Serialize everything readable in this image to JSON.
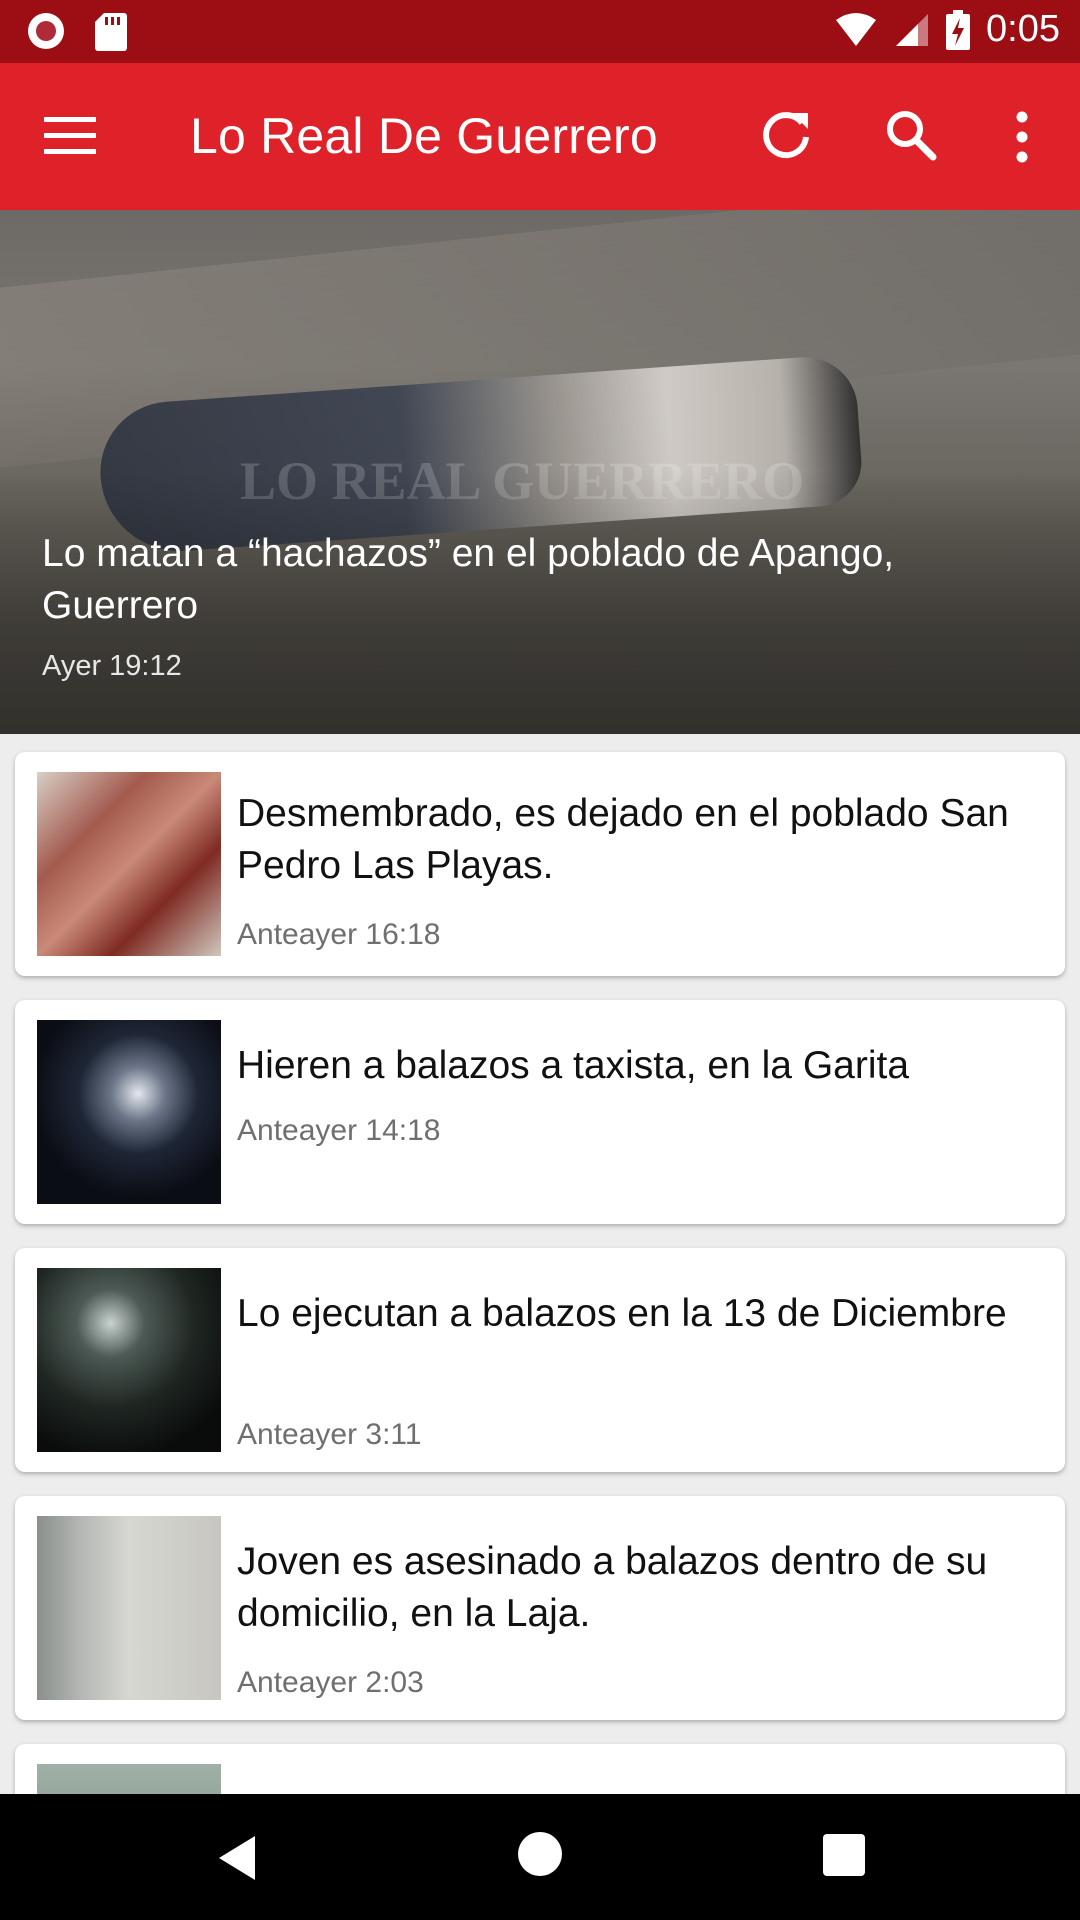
{
  "status_bar": {
    "time": "0:05",
    "icons": [
      "record-icon",
      "sd-card-icon",
      "wifi-icon",
      "signal-icon",
      "battery-charging-icon"
    ],
    "color": "#9c0d14"
  },
  "app_bar": {
    "title": "Lo Real De Guerrero",
    "color": "#df2229",
    "icons": [
      "menu-icon",
      "refresh-icon",
      "search-icon",
      "more-vert-icon"
    ]
  },
  "featured": {
    "title": "Lo matan a “hachazos” en el poblado de Apango, Guerrero",
    "time": "Ayer 19:12",
    "watermark": "LO REAL GUERRERO"
  },
  "articles": [
    {
      "title": "Desmembrado, es dejado en el poblado San Pedro Las Playas.",
      "time": "Anteayer 16:18"
    },
    {
      "title": "Hieren a balazos a taxista, en la Garita",
      "time": "Anteayer 14:18"
    },
    {
      "title": "Lo ejecutan a balazos en la 13 de Diciembre",
      "time": "Anteayer 3:11"
    },
    {
      "title": "Joven es asesinado a balazos dentro de su domicilio, en la Laja.",
      "time": "Anteayer 2:03"
    }
  ],
  "nav_bar": {
    "icons": [
      "back-icon",
      "home-icon",
      "recent-apps-icon"
    ]
  }
}
